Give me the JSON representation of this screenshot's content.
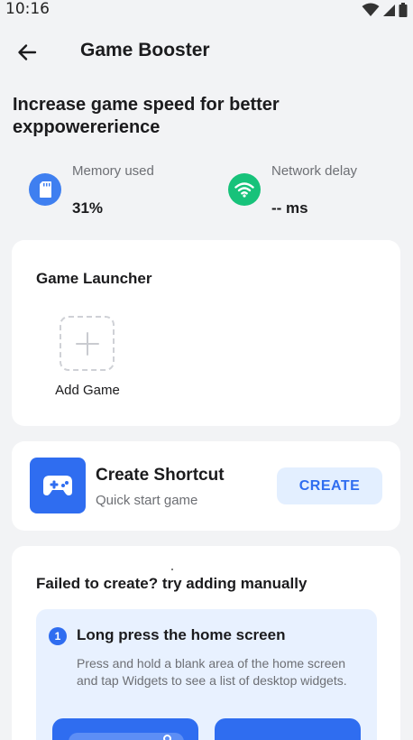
{
  "status_bar": {
    "time": "10:16",
    "icons": [
      "wifi-icon",
      "signal-icon",
      "battery-icon"
    ]
  },
  "app_bar": {
    "title": "Game Booster",
    "back_icon": "arrow-left-icon"
  },
  "headline": "Increase game speed for better exppowererience",
  "stats": {
    "memory": {
      "label": "Memory used",
      "value": "31%",
      "icon": "sd-card-icon",
      "color": "#3f7ff0"
    },
    "network": {
      "label": "Network delay",
      "value": "-- ms",
      "icon": "wifi-icon",
      "color": "#17c27a"
    }
  },
  "launcher": {
    "title": "Game Launcher",
    "add_label": "Add Game",
    "add_icon": "plus-icon"
  },
  "shortcut": {
    "title": "Create Shortcut",
    "subtitle": "Quick start game",
    "button_label": "CREATE",
    "icon": "gamepad-icon",
    "accent": "#2f6df0"
  },
  "manual": {
    "title": "Failed to create? try adding manually",
    "step": {
      "number": "1",
      "title": "Long press the home screen",
      "description": "Press and hold a blank area of the home screen and tap Widgets to see a list of desktop widgets."
    }
  }
}
